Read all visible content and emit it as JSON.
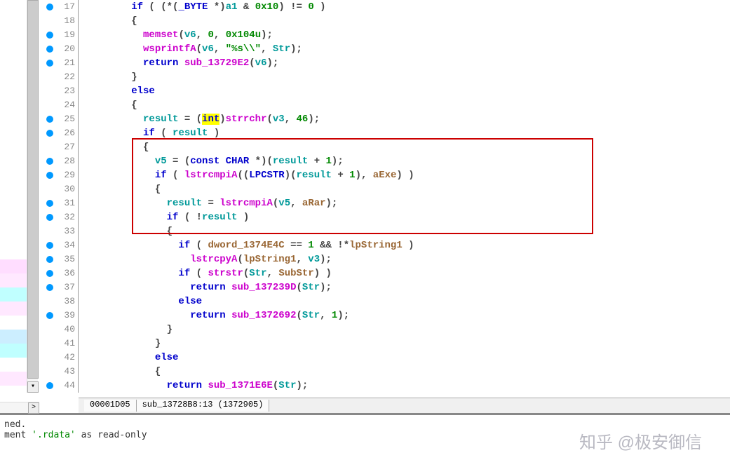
{
  "lines": [
    {
      "num": 17,
      "bp": true,
      "indent": 4,
      "tokens": [
        {
          "t": "if",
          "c": "kw"
        },
        {
          "t": " ( (*(",
          "c": "punct"
        },
        {
          "t": "_BYTE",
          "c": "type"
        },
        {
          "t": " *)",
          "c": "punct"
        },
        {
          "t": "a1",
          "c": "var"
        },
        {
          "t": " & ",
          "c": "punct"
        },
        {
          "t": "0x10",
          "c": "num"
        },
        {
          "t": ") != ",
          "c": "punct"
        },
        {
          "t": "0",
          "c": "num"
        },
        {
          "t": " )",
          "c": "punct"
        }
      ]
    },
    {
      "num": 18,
      "bp": false,
      "indent": 4,
      "tokens": [
        {
          "t": "{",
          "c": "punct"
        }
      ]
    },
    {
      "num": 19,
      "bp": true,
      "indent": 5,
      "tokens": [
        {
          "t": "memset",
          "c": "libfunc"
        },
        {
          "t": "(",
          "c": "punct"
        },
        {
          "t": "v6",
          "c": "var"
        },
        {
          "t": ", ",
          "c": "punct"
        },
        {
          "t": "0",
          "c": "num"
        },
        {
          "t": ", ",
          "c": "punct"
        },
        {
          "t": "0x104u",
          "c": "num"
        },
        {
          "t": ");",
          "c": "punct"
        }
      ]
    },
    {
      "num": 20,
      "bp": true,
      "indent": 5,
      "tokens": [
        {
          "t": "wsprintfA",
          "c": "libfunc"
        },
        {
          "t": "(",
          "c": "punct"
        },
        {
          "t": "v6",
          "c": "var"
        },
        {
          "t": ", ",
          "c": "punct"
        },
        {
          "t": "\"%s\\\\\"",
          "c": "str"
        },
        {
          "t": ", ",
          "c": "punct"
        },
        {
          "t": "Str",
          "c": "var"
        },
        {
          "t": ");",
          "c": "punct"
        }
      ]
    },
    {
      "num": 21,
      "bp": true,
      "indent": 5,
      "tokens": [
        {
          "t": "return",
          "c": "kw"
        },
        {
          "t": " ",
          "c": "punct"
        },
        {
          "t": "sub_13729E2",
          "c": "func"
        },
        {
          "t": "(",
          "c": "punct"
        },
        {
          "t": "v6",
          "c": "var"
        },
        {
          "t": ");",
          "c": "punct"
        }
      ]
    },
    {
      "num": 22,
      "bp": false,
      "indent": 4,
      "tokens": [
        {
          "t": "}",
          "c": "punct"
        }
      ]
    },
    {
      "num": 23,
      "bp": false,
      "indent": 4,
      "tokens": [
        {
          "t": "else",
          "c": "kw"
        }
      ]
    },
    {
      "num": 24,
      "bp": false,
      "indent": 4,
      "tokens": [
        {
          "t": "{",
          "c": "punct"
        }
      ]
    },
    {
      "num": 25,
      "bp": true,
      "indent": 5,
      "tokens": [
        {
          "t": "result",
          "c": "var"
        },
        {
          "t": " = (",
          "c": "punct"
        },
        {
          "t": "int",
          "c": "type",
          "hl": true
        },
        {
          "t": ")",
          "c": "punct"
        },
        {
          "t": "strrchr",
          "c": "libfunc"
        },
        {
          "t": "(",
          "c": "punct"
        },
        {
          "t": "v3",
          "c": "var"
        },
        {
          "t": ", ",
          "c": "punct"
        },
        {
          "t": "46",
          "c": "num"
        },
        {
          "t": ");",
          "c": "punct"
        }
      ]
    },
    {
      "num": 26,
      "bp": true,
      "indent": 5,
      "tokens": [
        {
          "t": "if",
          "c": "kw"
        },
        {
          "t": " ( ",
          "c": "punct"
        },
        {
          "t": "result",
          "c": "var"
        },
        {
          "t": " )",
          "c": "punct"
        }
      ]
    },
    {
      "num": 27,
      "bp": false,
      "indent": 5,
      "tokens": [
        {
          "t": "{",
          "c": "punct"
        }
      ]
    },
    {
      "num": 28,
      "bp": true,
      "indent": 6,
      "tokens": [
        {
          "t": "v5",
          "c": "var"
        },
        {
          "t": " = (",
          "c": "punct"
        },
        {
          "t": "const CHAR",
          "c": "type"
        },
        {
          "t": " *)(",
          "c": "punct"
        },
        {
          "t": "result",
          "c": "var"
        },
        {
          "t": " + ",
          "c": "punct"
        },
        {
          "t": "1",
          "c": "num"
        },
        {
          "t": ");",
          "c": "punct"
        }
      ]
    },
    {
      "num": 29,
      "bp": true,
      "indent": 6,
      "tokens": [
        {
          "t": "if",
          "c": "kw"
        },
        {
          "t": " ( ",
          "c": "punct"
        },
        {
          "t": "lstrcmpiA",
          "c": "libfunc"
        },
        {
          "t": "((",
          "c": "punct"
        },
        {
          "t": "LPCSTR",
          "c": "type"
        },
        {
          "t": ")(",
          "c": "punct"
        },
        {
          "t": "result",
          "c": "var"
        },
        {
          "t": " + ",
          "c": "punct"
        },
        {
          "t": "1",
          "c": "num"
        },
        {
          "t": "), ",
          "c": "punct"
        },
        {
          "t": "aExe",
          "c": "gvar"
        },
        {
          "t": ") )",
          "c": "punct"
        }
      ]
    },
    {
      "num": 30,
      "bp": false,
      "indent": 6,
      "tokens": [
        {
          "t": "{",
          "c": "punct"
        }
      ]
    },
    {
      "num": 31,
      "bp": true,
      "indent": 7,
      "tokens": [
        {
          "t": "result",
          "c": "var"
        },
        {
          "t": " = ",
          "c": "punct"
        },
        {
          "t": "lstrcmpiA",
          "c": "libfunc"
        },
        {
          "t": "(",
          "c": "punct"
        },
        {
          "t": "v5",
          "c": "var"
        },
        {
          "t": ", ",
          "c": "punct"
        },
        {
          "t": "aRar",
          "c": "gvar"
        },
        {
          "t": ");",
          "c": "punct"
        }
      ]
    },
    {
      "num": 32,
      "bp": true,
      "indent": 7,
      "tokens": [
        {
          "t": "if",
          "c": "kw"
        },
        {
          "t": " ( !",
          "c": "punct"
        },
        {
          "t": "result",
          "c": "var"
        },
        {
          "t": " )",
          "c": "punct"
        }
      ]
    },
    {
      "num": 33,
      "bp": false,
      "indent": 7,
      "tokens": [
        {
          "t": "{",
          "c": "punct"
        }
      ]
    },
    {
      "num": 34,
      "bp": true,
      "indent": 8,
      "tokens": [
        {
          "t": "if",
          "c": "kw"
        },
        {
          "t": " ( ",
          "c": "punct"
        },
        {
          "t": "dword_1374E4C",
          "c": "gvar"
        },
        {
          "t": " == ",
          "c": "punct"
        },
        {
          "t": "1",
          "c": "num"
        },
        {
          "t": " && !*",
          "c": "punct"
        },
        {
          "t": "lpString1",
          "c": "gvar"
        },
        {
          "t": " )",
          "c": "punct"
        }
      ]
    },
    {
      "num": 35,
      "bp": true,
      "indent": 9,
      "tokens": [
        {
          "t": "lstrcpyA",
          "c": "libfunc"
        },
        {
          "t": "(",
          "c": "punct"
        },
        {
          "t": "lpString1",
          "c": "gvar"
        },
        {
          "t": ", ",
          "c": "punct"
        },
        {
          "t": "v3",
          "c": "var"
        },
        {
          "t": ");",
          "c": "punct"
        }
      ]
    },
    {
      "num": 36,
      "bp": true,
      "indent": 8,
      "tokens": [
        {
          "t": "if",
          "c": "kw"
        },
        {
          "t": " ( ",
          "c": "punct"
        },
        {
          "t": "strstr",
          "c": "libfunc"
        },
        {
          "t": "(",
          "c": "punct"
        },
        {
          "t": "Str",
          "c": "var"
        },
        {
          "t": ", ",
          "c": "punct"
        },
        {
          "t": "SubStr",
          "c": "gvar"
        },
        {
          "t": ") )",
          "c": "punct"
        }
      ]
    },
    {
      "num": 37,
      "bp": true,
      "indent": 9,
      "tokens": [
        {
          "t": "return",
          "c": "kw"
        },
        {
          "t": " ",
          "c": "punct"
        },
        {
          "t": "sub_137239D",
          "c": "func"
        },
        {
          "t": "(",
          "c": "punct"
        },
        {
          "t": "Str",
          "c": "var"
        },
        {
          "t": ");",
          "c": "punct"
        }
      ]
    },
    {
      "num": 38,
      "bp": false,
      "indent": 8,
      "tokens": [
        {
          "t": "else",
          "c": "kw"
        }
      ]
    },
    {
      "num": 39,
      "bp": true,
      "indent": 9,
      "tokens": [
        {
          "t": "return",
          "c": "kw"
        },
        {
          "t": " ",
          "c": "punct"
        },
        {
          "t": "sub_1372692",
          "c": "func"
        },
        {
          "t": "(",
          "c": "punct"
        },
        {
          "t": "Str",
          "c": "var"
        },
        {
          "t": ", ",
          "c": "punct"
        },
        {
          "t": "1",
          "c": "num"
        },
        {
          "t": ");",
          "c": "punct"
        }
      ]
    },
    {
      "num": 40,
      "bp": false,
      "indent": 7,
      "tokens": [
        {
          "t": "}",
          "c": "punct"
        }
      ]
    },
    {
      "num": 41,
      "bp": false,
      "indent": 6,
      "tokens": [
        {
          "t": "}",
          "c": "punct"
        }
      ]
    },
    {
      "num": 42,
      "bp": false,
      "indent": 6,
      "tokens": [
        {
          "t": "else",
          "c": "kw"
        }
      ]
    },
    {
      "num": 43,
      "bp": false,
      "indent": 6,
      "tokens": [
        {
          "t": "{",
          "c": "punct"
        }
      ]
    },
    {
      "num": 44,
      "bp": true,
      "indent": 7,
      "tokens": [
        {
          "t": "return",
          "c": "kw"
        },
        {
          "t": " ",
          "c": "punct"
        },
        {
          "t": "sub_1371E6E",
          "c": "func"
        },
        {
          "t": "(",
          "c": "punct"
        },
        {
          "t": "Str",
          "c": "var"
        },
        {
          "t": ");",
          "c": "punct"
        }
      ]
    }
  ],
  "status": {
    "address": "00001D05",
    "function": "sub_13728B8:13 (1372905)"
  },
  "bottom": {
    "line1": "ned.",
    "line2_prefix": "ment ",
    "line2_str": "'.rdata'",
    "line2_mid": " as ",
    "line2_suffix": "read-only"
  },
  "watermark": "知乎 @极安御信",
  "minimap_colors": [
    "#ffddff",
    "#ffe8ff",
    "#c0ffff",
    "#ffe8ff",
    "#ffffff",
    "#cceeff",
    "#c0ffff",
    "#ffffff",
    "#ffe8ff"
  ],
  "scroll_right_glyph": ">",
  "scroll_down_glyph": "▾"
}
